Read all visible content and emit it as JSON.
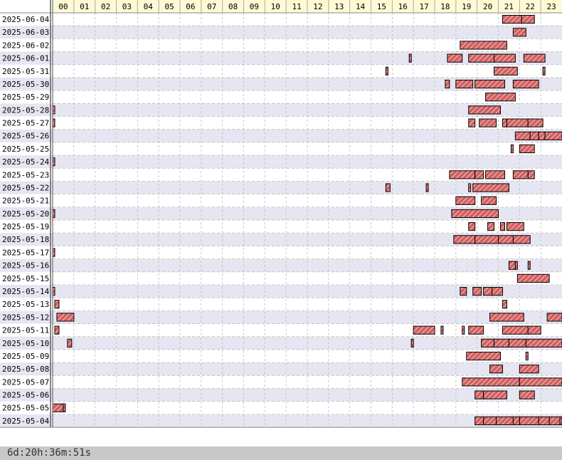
{
  "chart_data": {
    "type": "timeline",
    "x_ticks": [
      "00",
      "01",
      "02",
      "03",
      "04",
      "05",
      "06",
      "07",
      "08",
      "09",
      "10",
      "11",
      "12",
      "13",
      "14",
      "15",
      "16",
      "17",
      "18",
      "19",
      "20",
      "21",
      "22",
      "23"
    ],
    "xlim": [
      0,
      24
    ],
    "rows": [
      {
        "date": "2025-06-04",
        "segments": [
          [
            21.2,
            22.1
          ],
          [
            22.1,
            22.7
          ]
        ]
      },
      {
        "date": "2025-06-03",
        "segments": [
          [
            21.7,
            22.3
          ]
        ]
      },
      {
        "date": "2025-06-02",
        "segments": [
          [
            19.2,
            21.4
          ]
        ]
      },
      {
        "date": "2025-06-01",
        "segments": [
          [
            16.8,
            16.9
          ],
          [
            18.6,
            19.3
          ],
          [
            19.6,
            20.8
          ],
          [
            20.8,
            21.8
          ],
          [
            22.2,
            23.2
          ]
        ]
      },
      {
        "date": "2025-05-31",
        "segments": [
          [
            15.7,
            15.8
          ],
          [
            20.8,
            21.9
          ],
          [
            23.1,
            23.2
          ]
        ]
      },
      {
        "date": "2025-05-30",
        "segments": [
          [
            18.5,
            18.7
          ],
          [
            19.0,
            19.8
          ],
          [
            19.9,
            21.3
          ],
          [
            21.7,
            22.9
          ]
        ]
      },
      {
        "date": "2025-05-29",
        "segments": [
          [
            20.4,
            21.8
          ]
        ]
      },
      {
        "date": "2025-05-28",
        "segments": [
          [
            0.0,
            0.1
          ],
          [
            19.6,
            21.1
          ]
        ]
      },
      {
        "date": "2025-05-27",
        "segments": [
          [
            0.0,
            0.1
          ],
          [
            19.6,
            19.9
          ],
          [
            20.1,
            20.9
          ],
          [
            21.2,
            21.4
          ],
          [
            21.4,
            22.4
          ],
          [
            22.4,
            23.1
          ]
        ]
      },
      {
        "date": "2025-05-26",
        "segments": [
          [
            21.8,
            22.5
          ],
          [
            22.5,
            22.9
          ],
          [
            22.9,
            23.2
          ],
          [
            23.2,
            24.0
          ]
        ]
      },
      {
        "date": "2025-05-25",
        "segments": [
          [
            21.6,
            21.7
          ],
          [
            22.0,
            22.7
          ]
        ]
      },
      {
        "date": "2025-05-24",
        "segments": [
          [
            0.0,
            0.1
          ]
        ]
      },
      {
        "date": "2025-05-23",
        "segments": [
          [
            18.7,
            19.9
          ],
          [
            19.9,
            20.3
          ],
          [
            20.4,
            21.3
          ],
          [
            21.7,
            22.4
          ],
          [
            22.4,
            22.7
          ]
        ]
      },
      {
        "date": "2025-05-22",
        "segments": [
          [
            15.7,
            15.9
          ],
          [
            17.6,
            17.7
          ],
          [
            19.6,
            19.7
          ],
          [
            19.8,
            21.5
          ]
        ]
      },
      {
        "date": "2025-05-21",
        "segments": [
          [
            19.0,
            19.9
          ],
          [
            20.2,
            20.9
          ]
        ]
      },
      {
        "date": "2025-05-20",
        "segments": [
          [
            0.0,
            0.1
          ],
          [
            18.8,
            21.0
          ]
        ]
      },
      {
        "date": "2025-05-19",
        "segments": [
          [
            19.6,
            19.9
          ],
          [
            20.5,
            20.8
          ],
          [
            21.1,
            21.3
          ],
          [
            21.4,
            22.2
          ]
        ]
      },
      {
        "date": "2025-05-18",
        "segments": [
          [
            18.9,
            19.9
          ],
          [
            19.9,
            21.0
          ],
          [
            21.0,
            21.7
          ],
          [
            21.7,
            22.5
          ]
        ]
      },
      {
        "date": "2025-05-17",
        "segments": [
          [
            0.0,
            0.1
          ]
        ]
      },
      {
        "date": "2025-05-16",
        "segments": [
          [
            21.5,
            21.8
          ],
          [
            21.8,
            21.9
          ],
          [
            22.4,
            22.5
          ]
        ]
      },
      {
        "date": "2025-05-15",
        "segments": [
          [
            21.9,
            23.4
          ]
        ]
      },
      {
        "date": "2025-05-14",
        "segments": [
          [
            0.0,
            0.1
          ],
          [
            19.2,
            19.5
          ],
          [
            19.8,
            20.2
          ],
          [
            20.3,
            20.7
          ],
          [
            20.7,
            21.2
          ]
        ]
      },
      {
        "date": "2025-05-13",
        "segments": [
          [
            0.1,
            0.3
          ],
          [
            21.2,
            21.4
          ]
        ]
      },
      {
        "date": "2025-05-12",
        "segments": [
          [
            0.2,
            1.0
          ],
          [
            20.6,
            22.2
          ],
          [
            23.3,
            24.0
          ]
        ]
      },
      {
        "date": "2025-05-11",
        "segments": [
          [
            0.1,
            0.3
          ],
          [
            17.0,
            18.0
          ],
          [
            18.3,
            18.4
          ],
          [
            19.3,
            19.4
          ],
          [
            19.6,
            20.3
          ],
          [
            21.2,
            22.4
          ],
          [
            22.4,
            23.0
          ]
        ]
      },
      {
        "date": "2025-05-10",
        "segments": [
          [
            0.7,
            0.9
          ],
          [
            16.9,
            17.0
          ],
          [
            20.2,
            20.8
          ],
          [
            20.8,
            21.5
          ],
          [
            21.5,
            22.3
          ],
          [
            22.3,
            24.0
          ]
        ]
      },
      {
        "date": "2025-05-09",
        "segments": [
          [
            19.5,
            21.1
          ],
          [
            22.3,
            22.4
          ]
        ]
      },
      {
        "date": "2025-05-08",
        "segments": [
          [
            20.6,
            21.2
          ],
          [
            22.0,
            22.9
          ]
        ]
      },
      {
        "date": "2025-05-07",
        "segments": [
          [
            19.3,
            22.0
          ],
          [
            22.0,
            24.0
          ]
        ]
      },
      {
        "date": "2025-05-06",
        "segments": [
          [
            19.9,
            20.3
          ],
          [
            20.3,
            21.4
          ],
          [
            22.0,
            22.7
          ]
        ]
      },
      {
        "date": "2025-05-05",
        "segments": [
          [
            0.0,
            0.5
          ],
          [
            0.5,
            0.6
          ]
        ]
      },
      {
        "date": "2025-05-04",
        "segments": [
          [
            19.9,
            20.3
          ],
          [
            20.3,
            20.9
          ],
          [
            20.9,
            21.7
          ],
          [
            21.7,
            22.0
          ],
          [
            22.0,
            22.9
          ],
          [
            22.9,
            23.4
          ],
          [
            23.4,
            23.9
          ],
          [
            23.9,
            24.0
          ]
        ]
      }
    ],
    "total_label": "6d:20h:36m:51s",
    "colors": {
      "bar_fill": "#d06060",
      "bar_hatch": "#f4c4c4",
      "bar_stroke": "#000000",
      "row_alt": "#e6e6f2",
      "header_bg": "#fffad4",
      "grid": "#bbbbbb",
      "footer_bg": "#c8c8c8"
    }
  }
}
